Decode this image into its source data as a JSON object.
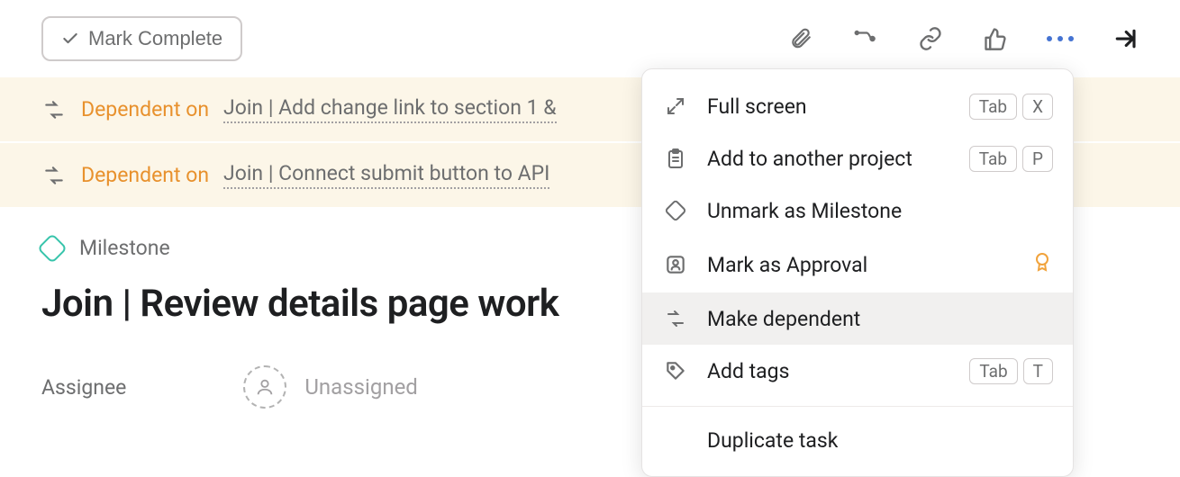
{
  "header": {
    "mark_complete": "Mark Complete"
  },
  "dependencies": [
    {
      "label": "Dependent on",
      "link": "Join | Add change link to section 1 &"
    },
    {
      "label": "Dependent on",
      "link": "Join | Connect submit button to API"
    }
  ],
  "milestone_label": "Milestone",
  "task_title": "Join | Review details page work",
  "assignee": {
    "label": "Assignee",
    "value": "Unassigned"
  },
  "menu": {
    "full_screen": {
      "label": "Full screen",
      "k1": "Tab",
      "k2": "X"
    },
    "add_project": {
      "label": "Add to another project",
      "k1": "Tab",
      "k2": "P"
    },
    "unmark_milestone": {
      "label": "Unmark as Milestone"
    },
    "mark_approval": {
      "label": "Mark as Approval"
    },
    "make_dependent": {
      "label": "Make dependent"
    },
    "add_tags": {
      "label": "Add tags",
      "k1": "Tab",
      "k2": "T"
    },
    "duplicate": {
      "label": "Duplicate task"
    }
  }
}
